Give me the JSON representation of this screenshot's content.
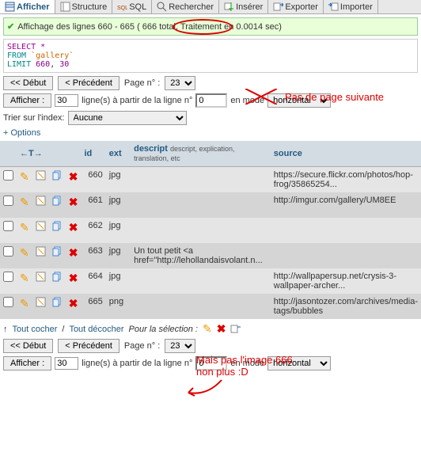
{
  "tabs": {
    "afficher": "Afficher",
    "structure": "Structure",
    "sql": "SQL",
    "rechercher": "Rechercher",
    "inserer": "Insérer",
    "exporter": "Exporter",
    "importer": "Importer"
  },
  "status": {
    "prefix": "Affichage des lignes 660 - 665",
    "count_paren": "( 666 total,",
    "suffix": "Traitement en 0.0014 sec)"
  },
  "sql": {
    "select": "SELECT *",
    "from": "FROM",
    "table": "`gallery`",
    "limit": "LIMIT",
    "n1": "660",
    "comma": ", ",
    "n2": "30"
  },
  "pager1": {
    "debut": "<< Début",
    "precedent": "< Précédent",
    "page_label": "Page n° :",
    "page_value": "23"
  },
  "display1": {
    "btn": "Afficher :",
    "count": "30",
    "mid": "ligne(s) à partir de la ligne n°",
    "start": "0",
    "mode_label": "en mode",
    "mode": "horizontal"
  },
  "sort": {
    "label": "Trier sur l'index:",
    "value": "Aucune"
  },
  "options": "+ Options",
  "headers": {
    "arrows": "←T→",
    "id": "id",
    "ext": "ext",
    "descript": "descript",
    "descript_sub": "descript, explication, translation, etc",
    "source": "source"
  },
  "rows": [
    {
      "id": "660",
      "ext": "jpg",
      "descript": "",
      "source": "https://secure.flickr.com/photos/hop-frog/35865254..."
    },
    {
      "id": "661",
      "ext": "jpg",
      "descript": "",
      "source": "http://imgur.com/gallery/UM8EE"
    },
    {
      "id": "662",
      "ext": "jpg",
      "descript": "",
      "source": ""
    },
    {
      "id": "663",
      "ext": "jpg",
      "descript": "Un tout petit <a href=\"http://lehollandaisvolant.n...",
      "source": ""
    },
    {
      "id": "664",
      "ext": "jpg",
      "descript": "",
      "source": "http://wallpapersup.net/crysis-3-wallpaper-archer..."
    },
    {
      "id": "665",
      "ext": "png",
      "descript": "",
      "source": "http://jasontozer.com/archives/media-tags/bubbles"
    }
  ],
  "footer": {
    "arrow": "↑",
    "tout_cocher": "Tout cocher",
    "sep": "/",
    "tout_decocher": "Tout décocher",
    "selection": "Pour la sélection :"
  },
  "pager2": {
    "debut": "<< Début",
    "precedent": "< Précédent",
    "page_label": "Page n° :",
    "page_value": "23"
  },
  "display2": {
    "btn": "Afficher :",
    "count": "30",
    "mid": "ligne(s) à partir de la ligne n°",
    "start": "0",
    "mode_label": "en mode",
    "mode": "horizontal"
  },
  "annotations": {
    "no_next": "Pas de page suivante",
    "no_666": "Mais pas l'image 666\nnon plus :D"
  }
}
